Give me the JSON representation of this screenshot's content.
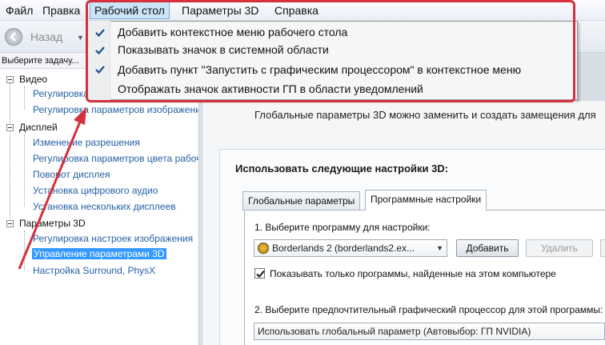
{
  "menubar": {
    "items": [
      "Файл",
      "Правка",
      "Рабочий стол",
      "Параметры 3D",
      "Справка"
    ]
  },
  "toolbar": {
    "back_label": "Назад"
  },
  "dropdown": {
    "items": [
      {
        "label": "Добавить контекстное меню рабочего стола",
        "checked": true
      },
      {
        "label": "Показывать значок в системной области",
        "checked": true
      },
      {
        "label": "Добавить пункт \"Запустить с графическим процессором\" в контекстное меню",
        "checked": true
      },
      {
        "label": "Отображать значок активности ГП в области уведомлений",
        "checked": false
      }
    ]
  },
  "left_panel": {
    "task_header": "Выберите задачу...",
    "tree": [
      {
        "label": "Видео",
        "children": [
          "Регулировка",
          "Регулировка параметров изображения"
        ]
      },
      {
        "label": "Дисплей",
        "children": [
          "Изменение разрешения",
          "Регулировка параметров цвета рабочего стола",
          "Поворот дисплея",
          "Установка цифрового аудио",
          "Установка нескольких дисплеев"
        ]
      },
      {
        "label": "Параметры 3D",
        "children": [
          "Регулировка настроек изображения",
          "Управление параметрами 3D",
          "Настройка Surround, PhysX"
        ]
      }
    ],
    "selected": "Управление параметрами 3D"
  },
  "main": {
    "description": "Глобальные параметры 3D можно заменить и создать замещения для",
    "settings_title": "Использовать следующие настройки 3D:",
    "tabs": [
      "Глобальные параметры",
      "Программные настройки"
    ],
    "active_tab": "Программные настройки",
    "step1_label": "1. Выберите программу для настройки:",
    "program_value": "Borderlands 2 (borderlands2.ex...",
    "add_button": "Добавить",
    "remove_button": "Удалить",
    "show_only_label": "Показывать только программы, найденные на этом компьютере",
    "show_only_checked": true,
    "step2_label": "2. Выберите предпочтительный графический процессор для этой программы:",
    "gpu_value": "Использовать глобальный параметр (Автовыбор: ГП NVIDIA)"
  },
  "colors": {
    "annotation": "#d6303d",
    "selected": "#3399ff",
    "link": "#2460a7"
  }
}
